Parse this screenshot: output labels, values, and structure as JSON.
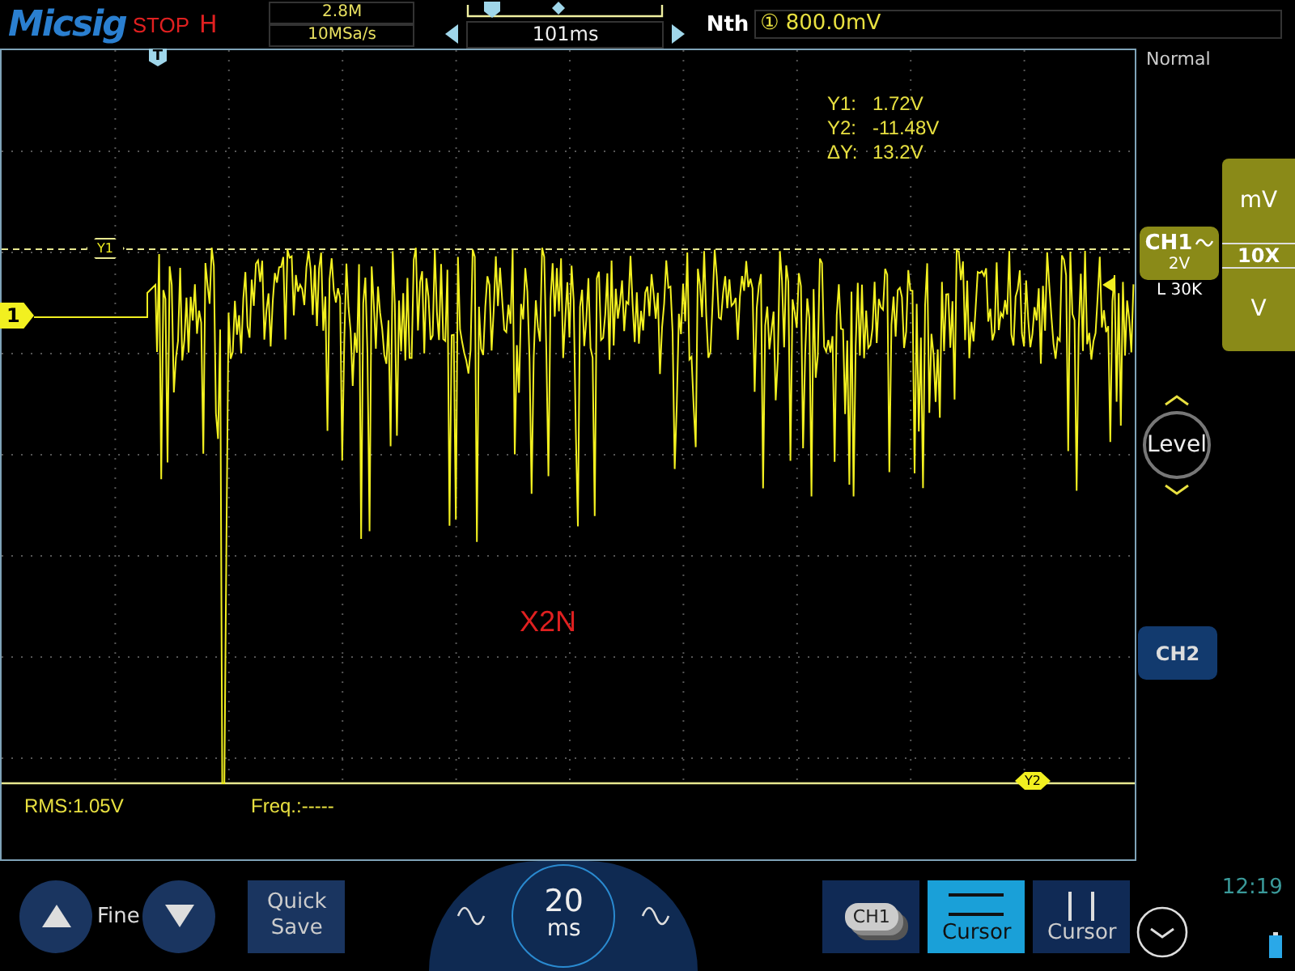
{
  "header": {
    "logo": "Micsig",
    "run_state": "STOP",
    "timebase_mode": "H",
    "memory_depth": "2.8M",
    "sample_rate": "10MSa/s",
    "time_offset": "101ms",
    "trigger_type": "Nth",
    "trigger_source": "①",
    "trigger_level": "800.0mV"
  },
  "trigger_status": "Normal",
  "cursor_readout": [
    {
      "label": "Y1:",
      "value": "1.72V"
    },
    {
      "label": "Y2:",
      "value": "-11.48V"
    },
    {
      "label": "ΔY:",
      "value": "13.2V"
    }
  ],
  "markers": {
    "trigger_position": "T",
    "channel": "1",
    "cursor_1": "Y1",
    "cursor_2": "Y2"
  },
  "overlay_text": "X2N",
  "measurements": [
    "RMS:1.05V",
    "Freq.:-----"
  ],
  "channel_panel": {
    "ch1_label": "CH1",
    "ch1_scale": "2V",
    "ch1_info": "L 30K",
    "units": [
      {
        "label": "mV",
        "selected": false
      },
      {
        "label": "10X",
        "selected": true
      },
      {
        "label": "V",
        "selected": false
      }
    ],
    "level_label": "Level",
    "ch2_label": "CH2"
  },
  "bottom": {
    "fine_label": "Fine",
    "quick_save": "Quick Save",
    "timebase_value": "20",
    "timebase_unit": "ms",
    "buttons": [
      {
        "kind": "channel",
        "label": "CH1",
        "selected": false
      },
      {
        "kind": "horizontal_cursor",
        "label": "Cursor",
        "selected": true
      },
      {
        "kind": "vertical_cursor",
        "label": "Cursor",
        "selected": false
      }
    ],
    "clock": "12:19"
  }
}
